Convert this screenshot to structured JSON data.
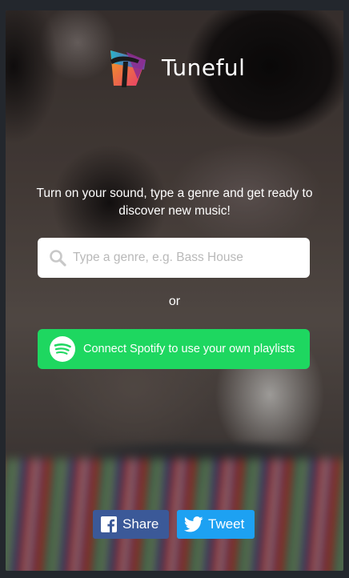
{
  "app": {
    "brand_name": "Tuneful"
  },
  "hero": {
    "tagline": "Turn on your sound, type a genre and get ready to discover new music!"
  },
  "search": {
    "placeholder": "Type a genre, e.g. Bass House",
    "value": "",
    "icon": "search-icon"
  },
  "divider": {
    "or_text": "or"
  },
  "spotify": {
    "label": "Connect Spotify to use your own playlists",
    "icon": "spotify-icon",
    "color": "#1ed760"
  },
  "share": {
    "facebook_label": "Share",
    "facebook_icon": "facebook-icon",
    "facebook_color": "#3b5998",
    "twitter_label": "Tweet",
    "twitter_icon": "twitter-icon",
    "twitter_color": "#1da1f2"
  }
}
